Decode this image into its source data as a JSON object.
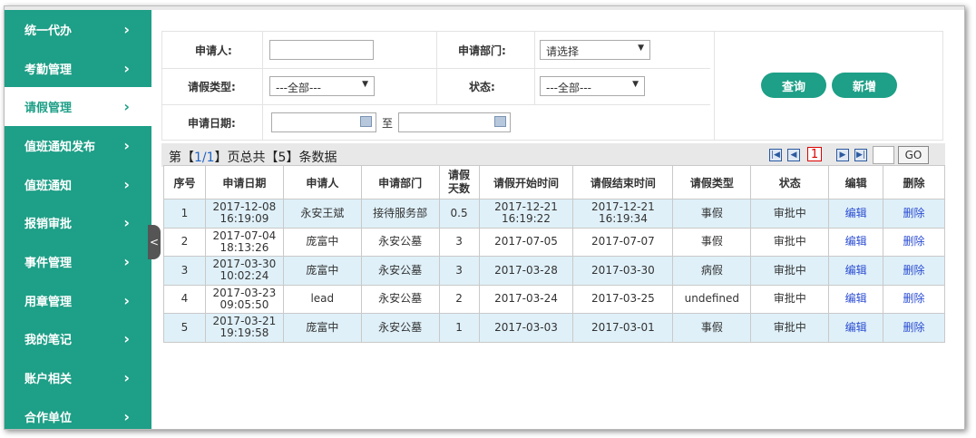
{
  "sidebar": {
    "items": [
      {
        "label": "统一代办"
      },
      {
        "label": "考勤管理"
      },
      {
        "label": "请假管理"
      },
      {
        "label": "值班通知发布"
      },
      {
        "label": "值班通知"
      },
      {
        "label": "报销审批"
      },
      {
        "label": "事件管理"
      },
      {
        "label": "用章管理"
      },
      {
        "label": "我的笔记"
      },
      {
        "label": "账户相关"
      },
      {
        "label": "合作单位"
      }
    ],
    "chevron": "›",
    "collapse_glyph": "<"
  },
  "search": {
    "applicant_label": "申请人:",
    "applicant_value": "",
    "department_label": "申请部门:",
    "department_value": "请选择",
    "leave_type_label": "请假类型:",
    "leave_type_value": "---全部---",
    "status_label": "状态:",
    "status_value": "---全部---",
    "date_label": "申请日期:",
    "date_to": "至",
    "date_from_value": "",
    "date_to_value": "",
    "query_button": "查询",
    "add_button": "新增"
  },
  "pager": {
    "prefix": "第【",
    "current": "1/1",
    "middle": "】页总共【",
    "total": "5",
    "suffix": "】条数据",
    "current_page_box": "1",
    "go_button": "GO"
  },
  "table": {
    "headers": [
      "序号",
      "申请日期",
      "申请人",
      "申请部门",
      "请假天数",
      "请假开始时间",
      "请假结束时间",
      "请假类型",
      "状态",
      "编辑",
      "删除"
    ],
    "rows": [
      [
        "1",
        "2017-12-08 16:19:09",
        "永安王斌",
        "接待服务部",
        "0.5",
        "2017-12-21 16:19:22",
        "2017-12-21 16:19:34",
        "事假",
        "审批中",
        "编辑",
        "删除"
      ],
      [
        "2",
        "2017-07-04 18:13:26",
        "庞富中",
        "永安公墓",
        "3",
        "2017-07-05",
        "2017-07-07",
        "事假",
        "审批中",
        "编辑",
        "删除"
      ],
      [
        "3",
        "2017-03-30 10:02:24",
        "庞富中",
        "永安公墓",
        "3",
        "2017-03-28",
        "2017-03-30",
        "病假",
        "审批中",
        "编辑",
        "删除"
      ],
      [
        "4",
        "2017-03-23 09:05:50",
        "lead",
        "永安公墓",
        "2",
        "2017-03-24",
        "2017-03-25",
        "undefined",
        "审批中",
        "编辑",
        "删除"
      ],
      [
        "5",
        "2017-03-21 19:19:58",
        "庞富中",
        "永安公墓",
        "1",
        "2017-03-03",
        "2017-03-01",
        "事假",
        "审批中",
        "编辑",
        "删除"
      ]
    ]
  },
  "colors": {
    "accent": "#1e9f87",
    "row_highlight": "#dff0f8",
    "link": "#2a4cd2"
  }
}
